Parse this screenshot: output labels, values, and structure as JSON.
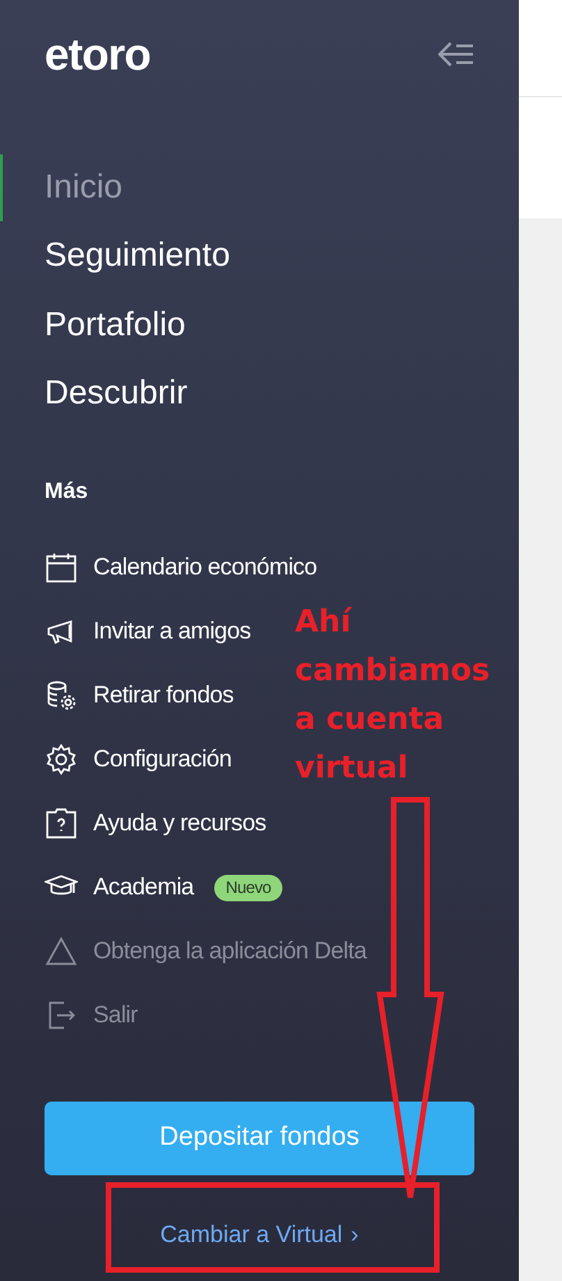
{
  "logo": {
    "text": "etoro"
  },
  "nav": [
    {
      "label": "Inicio",
      "selected": true
    },
    {
      "label": "Seguimiento",
      "selected": false
    },
    {
      "label": "Portafolio",
      "selected": false
    },
    {
      "label": "Descubrir",
      "selected": false
    }
  ],
  "more": {
    "heading": "Más",
    "items": [
      {
        "label": "Calendario económico",
        "kind": "calendar",
        "disabled": false
      },
      {
        "label": "Invitar a amigos",
        "kind": "megaphone",
        "disabled": false
      },
      {
        "label": "Retirar fondos",
        "kind": "coins",
        "disabled": false
      },
      {
        "label": "Configuración",
        "kind": "gear",
        "disabled": false
      },
      {
        "label": "Ayuda y recursos",
        "kind": "help",
        "disabled": false
      },
      {
        "label": "Academia",
        "kind": "cap",
        "disabled": false,
        "badge": "Nuevo"
      },
      {
        "label": "Obtenga la aplicación Delta",
        "kind": "triangle",
        "disabled": true
      },
      {
        "label": "Salir",
        "kind": "logout",
        "disabled": true
      }
    ]
  },
  "deposit_button": "Depositar fondos",
  "switch_link": {
    "label": "Cambiar a Virtual",
    "chevron": "›"
  },
  "annotation": {
    "lines": [
      "Ahí",
      "cambiamos",
      "a cuenta",
      "virtual"
    ]
  }
}
